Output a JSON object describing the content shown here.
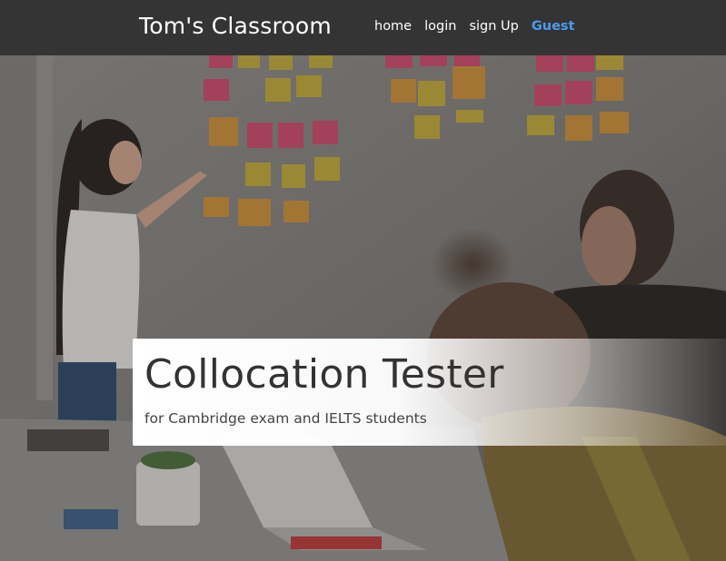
{
  "navbar": {
    "brand": "Tom's Classroom",
    "links": [
      {
        "label": "home"
      },
      {
        "label": "login"
      },
      {
        "label": "sign Up"
      },
      {
        "label": "Guest"
      }
    ],
    "active_color": "#4a9bf0",
    "background": "#343434"
  },
  "hero": {
    "title": "Collocation Tester",
    "subtitle": "for Cambridge exam and IELTS students",
    "image_description_icon": "classroom-photo"
  }
}
